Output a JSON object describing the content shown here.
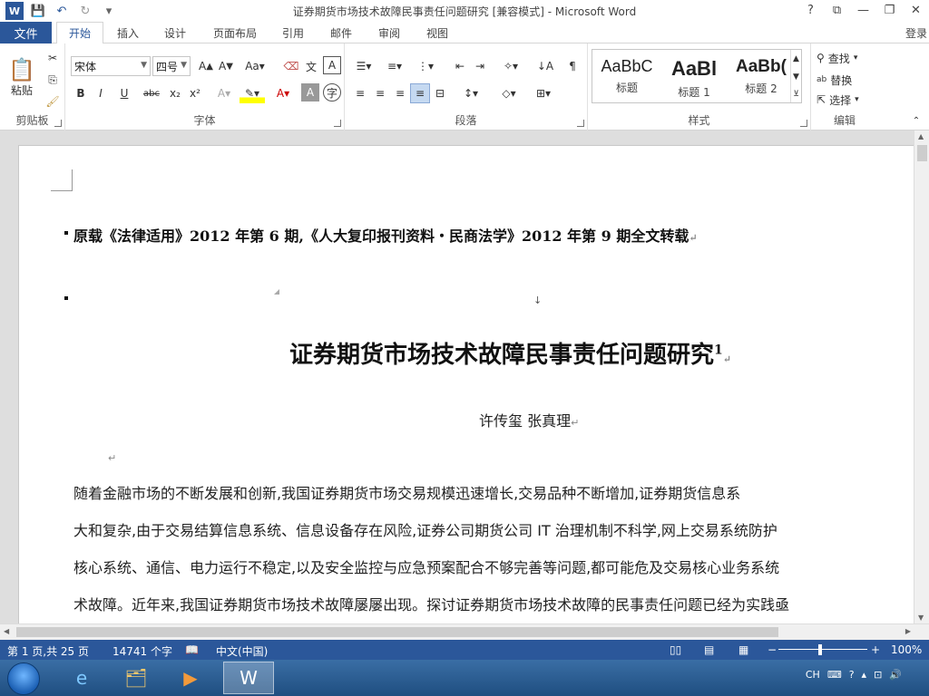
{
  "window": {
    "title": "证券期货市场技术故障民事责任问题研究 [兼容模式] - Microsoft Word",
    "help": "?",
    "controls": [
      "⧉",
      "—",
      "❐",
      "✕"
    ]
  },
  "tabs": {
    "file": "文件",
    "items": [
      "开始",
      "插入",
      "设计",
      "页面布局",
      "引用",
      "邮件",
      "审阅",
      "视图"
    ],
    "active": "开始",
    "login": "登录"
  },
  "ribbon": {
    "clipboard": {
      "paste": "粘贴",
      "label": "剪贴板"
    },
    "font": {
      "name": "宋体",
      "size": "四号",
      "label": "字体",
      "buttons": [
        "B",
        "I",
        "U",
        "abc",
        "x₂",
        "x²"
      ]
    },
    "paragraph": {
      "label": "段落"
    },
    "styles": {
      "label": "样式",
      "items": [
        {
          "sample": "AaBbC",
          "name": "标题"
        },
        {
          "sample": "AaBl",
          "name": "标题 1"
        },
        {
          "sample": "AaBb(",
          "name": "标题 2"
        }
      ]
    },
    "editing": {
      "label": "编辑",
      "find": "查找",
      "replace": "替换",
      "select": "选择"
    }
  },
  "document": {
    "note": "原载《法律适用》2012 年第 6 期,《人大复印报刊资料・民商法学》2012 年第 9 期全文转载",
    "title": "证券期货市场技术故障民事责任问题研究",
    "title_sup": "1",
    "authors": "许传玺  张真理",
    "para_lines": [
      "    随着金融市场的不断发展和创新,我国证券期货市场交易规模迅速增长,交易品种不断增加,证券期货信息系",
      "大和复杂,由于交易结算信息系统、信息设备存在风险,证券公司期货公司 IT 治理机制不科学,网上交易系统防护",
      "核心系统、通信、电力运行不稳定,以及安全监控与应急预案配合不够完善等问题,都可能危及交易核心业务系统",
      "术故障。近年来,我国证券期货市场技术故障屡屡出现。探讨证券期货市场技术故障的民事责任问题已经为实践亟"
    ]
  },
  "status": {
    "page": "第 1 页,共 25 页",
    "words": "14741 个字",
    "language": "中文(中国)",
    "zoom": "100%"
  },
  "taskbar": {
    "tray_lang": "CH"
  }
}
